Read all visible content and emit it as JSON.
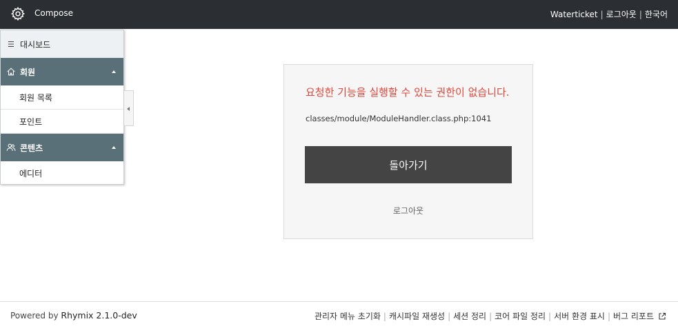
{
  "header": {
    "app_name": "Compose",
    "site_name": "Waterticket",
    "logout_label": "로그아웃",
    "language_label": "한국어"
  },
  "sidebar": {
    "dashboard_label": "대시보드",
    "groups": [
      {
        "label": "회원",
        "icon": "home-icon",
        "items": [
          "회원 목록",
          "포인트"
        ]
      },
      {
        "label": "콘텐츠",
        "icon": "users-icon",
        "items": [
          "에디터"
        ]
      }
    ]
  },
  "error": {
    "message": "요청한 기능을 실행할 수 있는 권한이 없습니다.",
    "location": "classes/module/ModuleHandler.class.php:1041",
    "back_button": "돌아가기",
    "logout_link": "로그아웃"
  },
  "footer": {
    "powered_prefix": "Powered by",
    "powered_name": "Rhymix 2.1.0-dev",
    "links": [
      "관리자 메뉴 초기화",
      "캐시파일 재생성",
      "세션 정리",
      "코어 파일 정리",
      "서버 환경 표시",
      "버그 리포트"
    ]
  },
  "colors": {
    "header_bg": "#2b2f33",
    "sidebar_group_bg": "#5a7079",
    "error_text": "#e2463a",
    "button_bg": "#444444"
  }
}
